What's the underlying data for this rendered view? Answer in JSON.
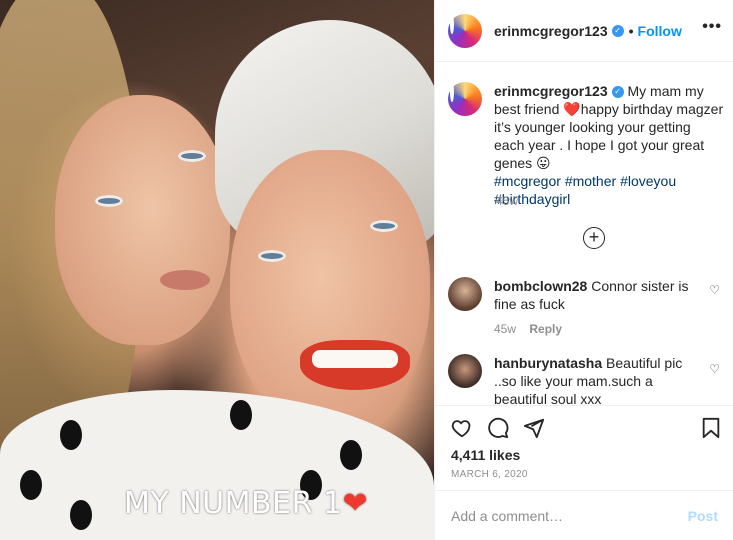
{
  "photo": {
    "overlay_text": "MY NUMBER 1",
    "overlay_emoji": "❤"
  },
  "header": {
    "username": "erinmcgregor123",
    "separator": "•",
    "follow_label": "Follow",
    "more_label": "•••"
  },
  "post_caption": {
    "username": "erinmcgregor123",
    "text_part1": " My mam my best friend ",
    "heart": "❤️",
    "text_part2": "happy birthday magzer it’s younger looking your getting each year . I hope I got your great genes 😛",
    "hashtags": [
      "#mcgregor",
      "#mother",
      "#loveyou",
      "#birthdaygirl"
    ],
    "time_ago": "45w"
  },
  "load_more_icon": "+",
  "comments": [
    {
      "username": "bombclown28",
      "text": "Connor sister is fine as fuck",
      "time_ago": "45w",
      "reply_label": "Reply",
      "like_icon": "♡"
    },
    {
      "username": "hanburynatasha",
      "text": "Beautiful pic ..so like your mam.such a beautiful soul xxx",
      "like_icon": "♡"
    }
  ],
  "likes": "4,411 likes",
  "date": "MARCH 6, 2020",
  "comment_input": {
    "placeholder": "Add a comment…",
    "post_label": "Post"
  }
}
